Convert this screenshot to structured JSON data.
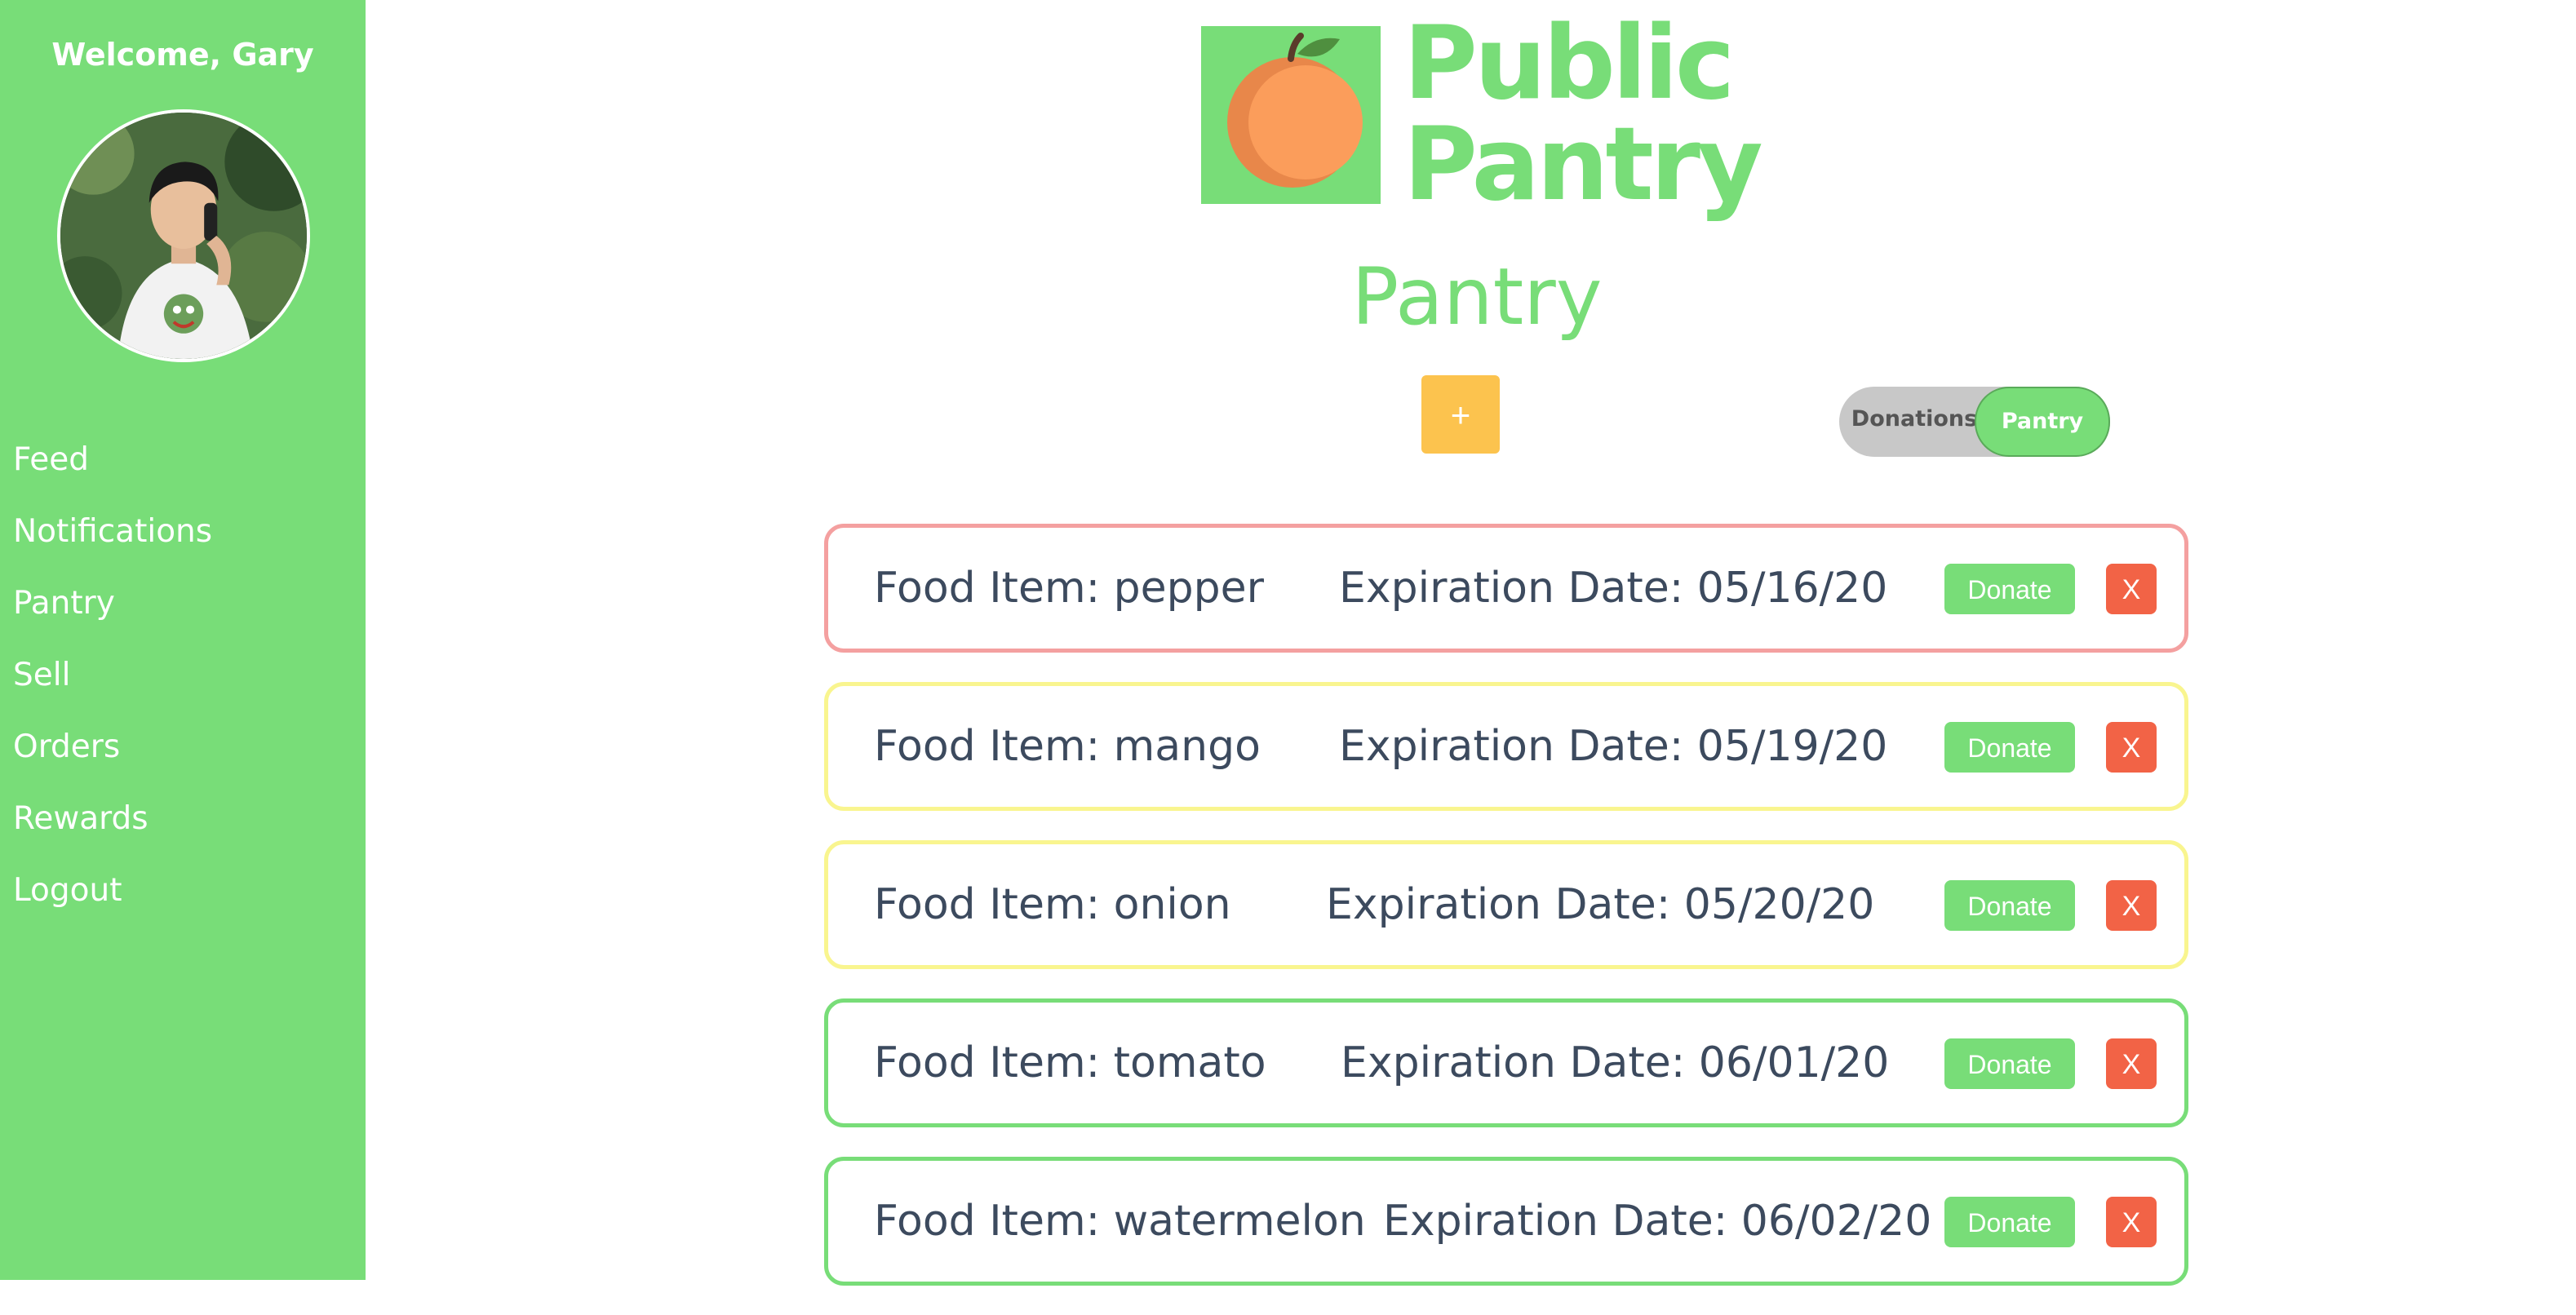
{
  "sidebar": {
    "welcome": "Welcome, Gary",
    "nav": [
      "Feed",
      "Notifications",
      "Pantry",
      "Sell",
      "Orders",
      "Rewards",
      "Logout"
    ]
  },
  "header": {
    "logo_line1": "Public",
    "logo_line2": "Pantry",
    "logo_icon": "peach-icon",
    "page_title": "Pantry"
  },
  "actions": {
    "add_label": "+"
  },
  "toggle": {
    "left_label": "Donations",
    "right_label": "Pantry",
    "selected": "Pantry"
  },
  "items": [
    {
      "name": "Food Item: pepper",
      "expiration": "Expiration Date: 05/16/20",
      "status_color": "#f4a0a0",
      "donate": "Donate",
      "remove": "X"
    },
    {
      "name": "Food Item: mango",
      "expiration": "Expiration Date: 05/19/20",
      "status_color": "#f9f58f",
      "donate": "Donate",
      "remove": "X"
    },
    {
      "name": "Food Item: onion",
      "expiration": "Expiration Date: 05/20/20",
      "status_color": "#f9f58f",
      "donate": "Donate",
      "remove": "X"
    },
    {
      "name": "Food Item: tomato",
      "expiration": "Expiration Date: 06/01/20",
      "status_color": "#78dd78",
      "donate": "Donate",
      "remove": "X"
    },
    {
      "name": "Food Item: watermelon",
      "expiration": "Expiration Date: 06/02/20",
      "status_color": "#78dd78",
      "donate": "Donate",
      "remove": "X"
    }
  ],
  "colors": {
    "brand_green": "#78dd78",
    "add_button": "#fcc34e",
    "remove_button": "#f26346",
    "expired_soon": "#f4a0a0",
    "expiring": "#f9f58f",
    "fresh": "#78dd78"
  }
}
